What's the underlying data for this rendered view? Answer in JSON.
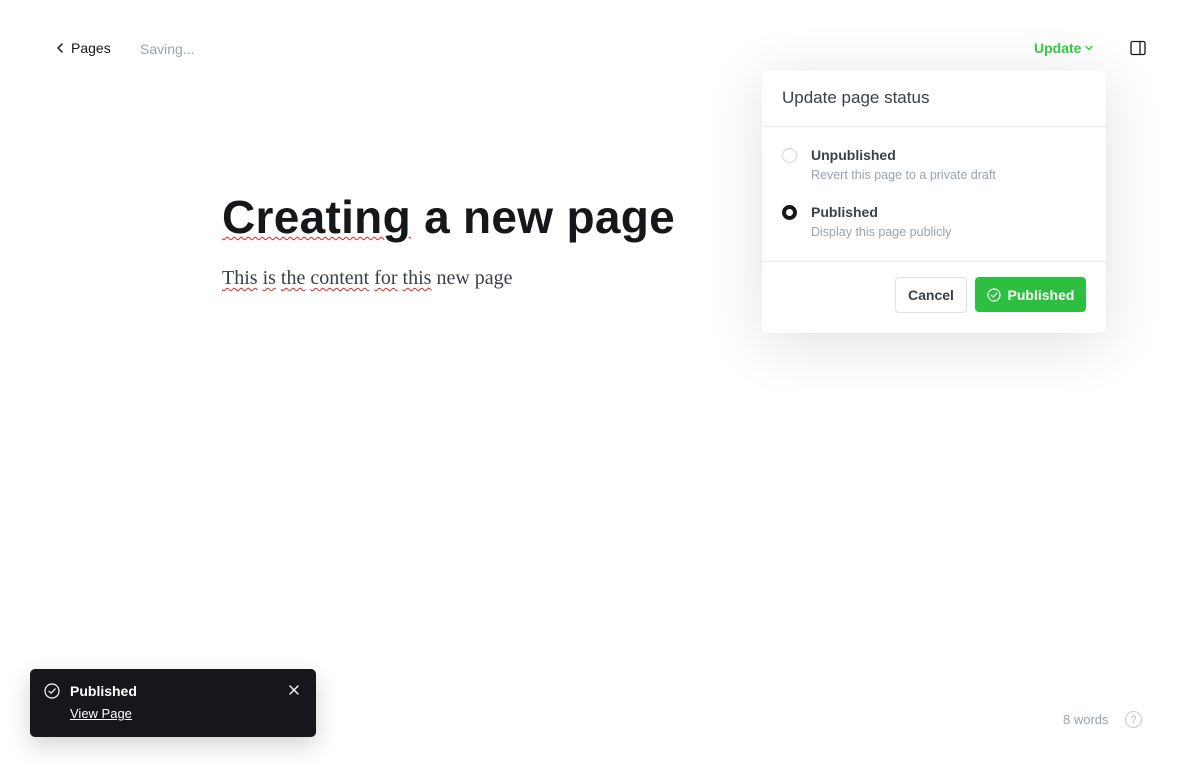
{
  "topbar": {
    "back_label": "Pages",
    "status_text": "Saving...",
    "update_label": "Update"
  },
  "editor": {
    "title_words": [
      "Creating",
      " a new page"
    ],
    "body_words": [
      "This",
      " ",
      "is",
      " ",
      "the",
      " ",
      "content",
      " ",
      "for",
      " ",
      "this",
      " new page"
    ]
  },
  "popover": {
    "title": "Update page status",
    "options": [
      {
        "label": "Unpublished",
        "description": "Revert this page to a private draft",
        "selected": false
      },
      {
        "label": "Published",
        "description": "Display this page publicly",
        "selected": true
      }
    ],
    "cancel_label": "Cancel",
    "confirm_label": "Published"
  },
  "toast": {
    "title": "Published",
    "link_label": "View Page"
  },
  "footer": {
    "word_count": "8 words",
    "help_symbol": "?"
  },
  "colors": {
    "accent_green": "#30cf43",
    "button_green": "#2dbf3f",
    "toast_bg": "#15171a"
  }
}
